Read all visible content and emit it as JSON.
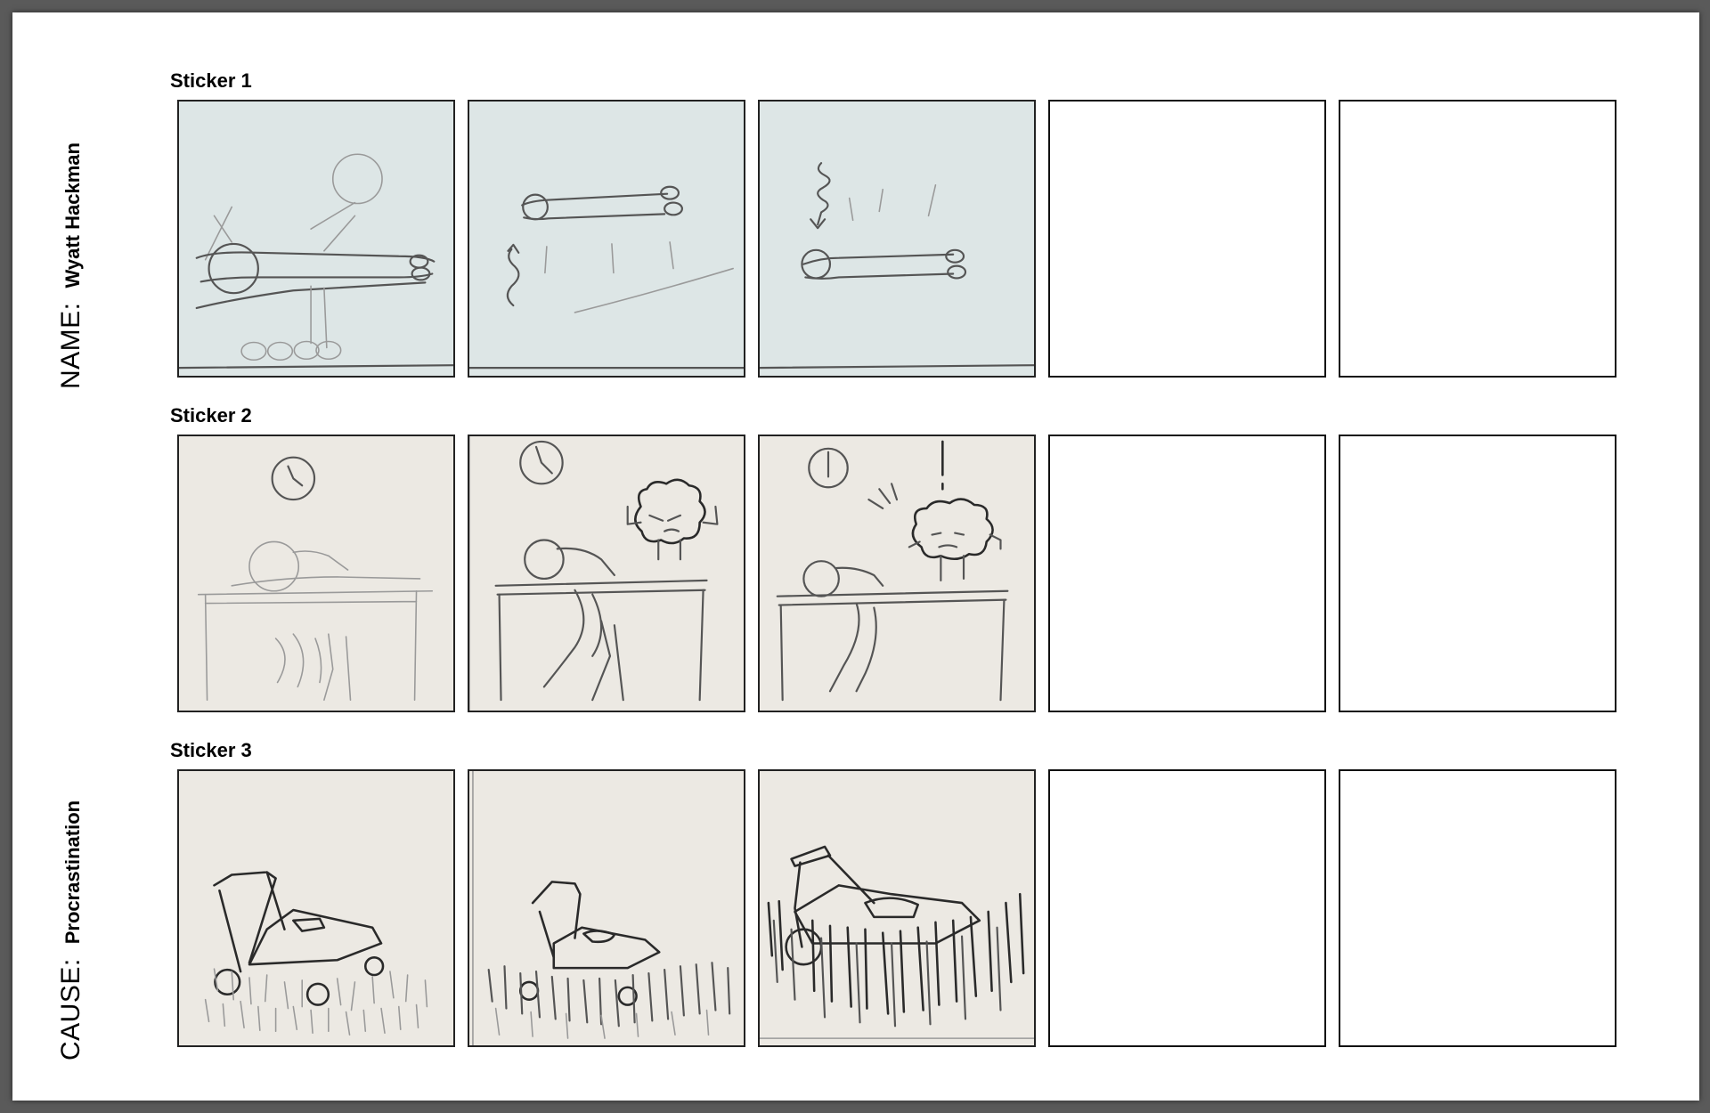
{
  "name": {
    "key": "NAME:",
    "value": "Wyatt Hackman"
  },
  "cause": {
    "key": "CAUSE:",
    "value": "Procrastination"
  },
  "stickers": [
    {
      "title": "Sticker 1",
      "frames": [
        "man-lying-on-bed",
        "man-floating-up",
        "man-falling-back",
        "blank",
        "blank"
      ]
    },
    {
      "title": "Sticker 2",
      "frames": [
        "man-asleep-at-desk",
        "brain-watching-sleeper",
        "brain-alarmed",
        "blank",
        "blank"
      ]
    },
    {
      "title": "Sticker 3",
      "frames": [
        "lawnmower-short-grass",
        "lawnmower-grass-growing",
        "lawnmower-tall-grass",
        "blank",
        "blank"
      ]
    }
  ],
  "colors": {
    "paper_blue": "#dde6e6",
    "paper_warm": "#ece9e3",
    "page": "#ffffff",
    "frame_border": "#111111"
  }
}
